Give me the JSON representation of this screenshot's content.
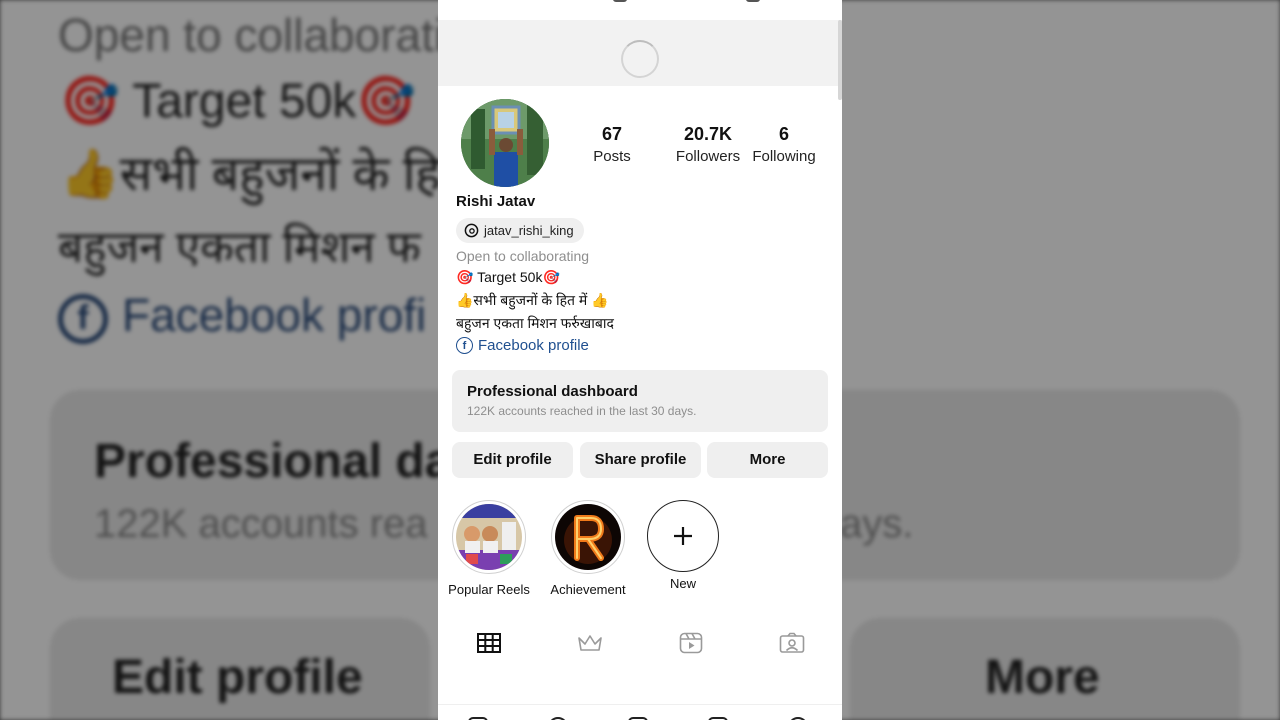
{
  "background": {
    "line1": "Open to collaborati",
    "line2": "🎯 Target 50k🎯",
    "line3": "👍सभी बहुजनों के हि",
    "line4": "बहुजन एकता मिशन फ",
    "line5": "Facebook profi",
    "dashboard_title": "Professional da",
    "dashboard_sub": "122K accounts rea",
    "dashboard_sub_end": "ays.",
    "edit_label": "Edit profile",
    "more_label": "More"
  },
  "profile": {
    "name": "Rishi Jatav",
    "threads_handle": "jatav_rishi_king",
    "stats": {
      "posts_count": "67",
      "posts_label": "Posts",
      "followers_count": "20.7K",
      "followers_label": "Followers",
      "following_count": "6",
      "following_label": "Following"
    },
    "category": "Open to collaborating",
    "bio_line1": "🎯 Target 50k🎯",
    "bio_line2": "👍सभी बहुजनों के हित में 👍",
    "bio_line3": "बहुजन एकता मिशन फर्रुखाबाद",
    "facebook_link": "Facebook profile"
  },
  "dashboard": {
    "title": "Professional dashboard",
    "subtitle": "122K accounts reached in the last 30 days."
  },
  "actions": {
    "edit": "Edit profile",
    "share": "Share profile",
    "more": "More"
  },
  "highlights": [
    {
      "label": "Popular Reels"
    },
    {
      "label": "Achievement"
    },
    {
      "label": "New"
    }
  ],
  "tabs": [
    {
      "icon": "grid-icon",
      "active": true
    },
    {
      "icon": "crown-icon",
      "active": false
    },
    {
      "icon": "reels-icon",
      "active": false
    },
    {
      "icon": "tagged-icon",
      "active": false
    }
  ],
  "colors": {
    "link": "#1f4f8f",
    "muted": "#8e8e8e",
    "button_bg": "#efefef"
  }
}
